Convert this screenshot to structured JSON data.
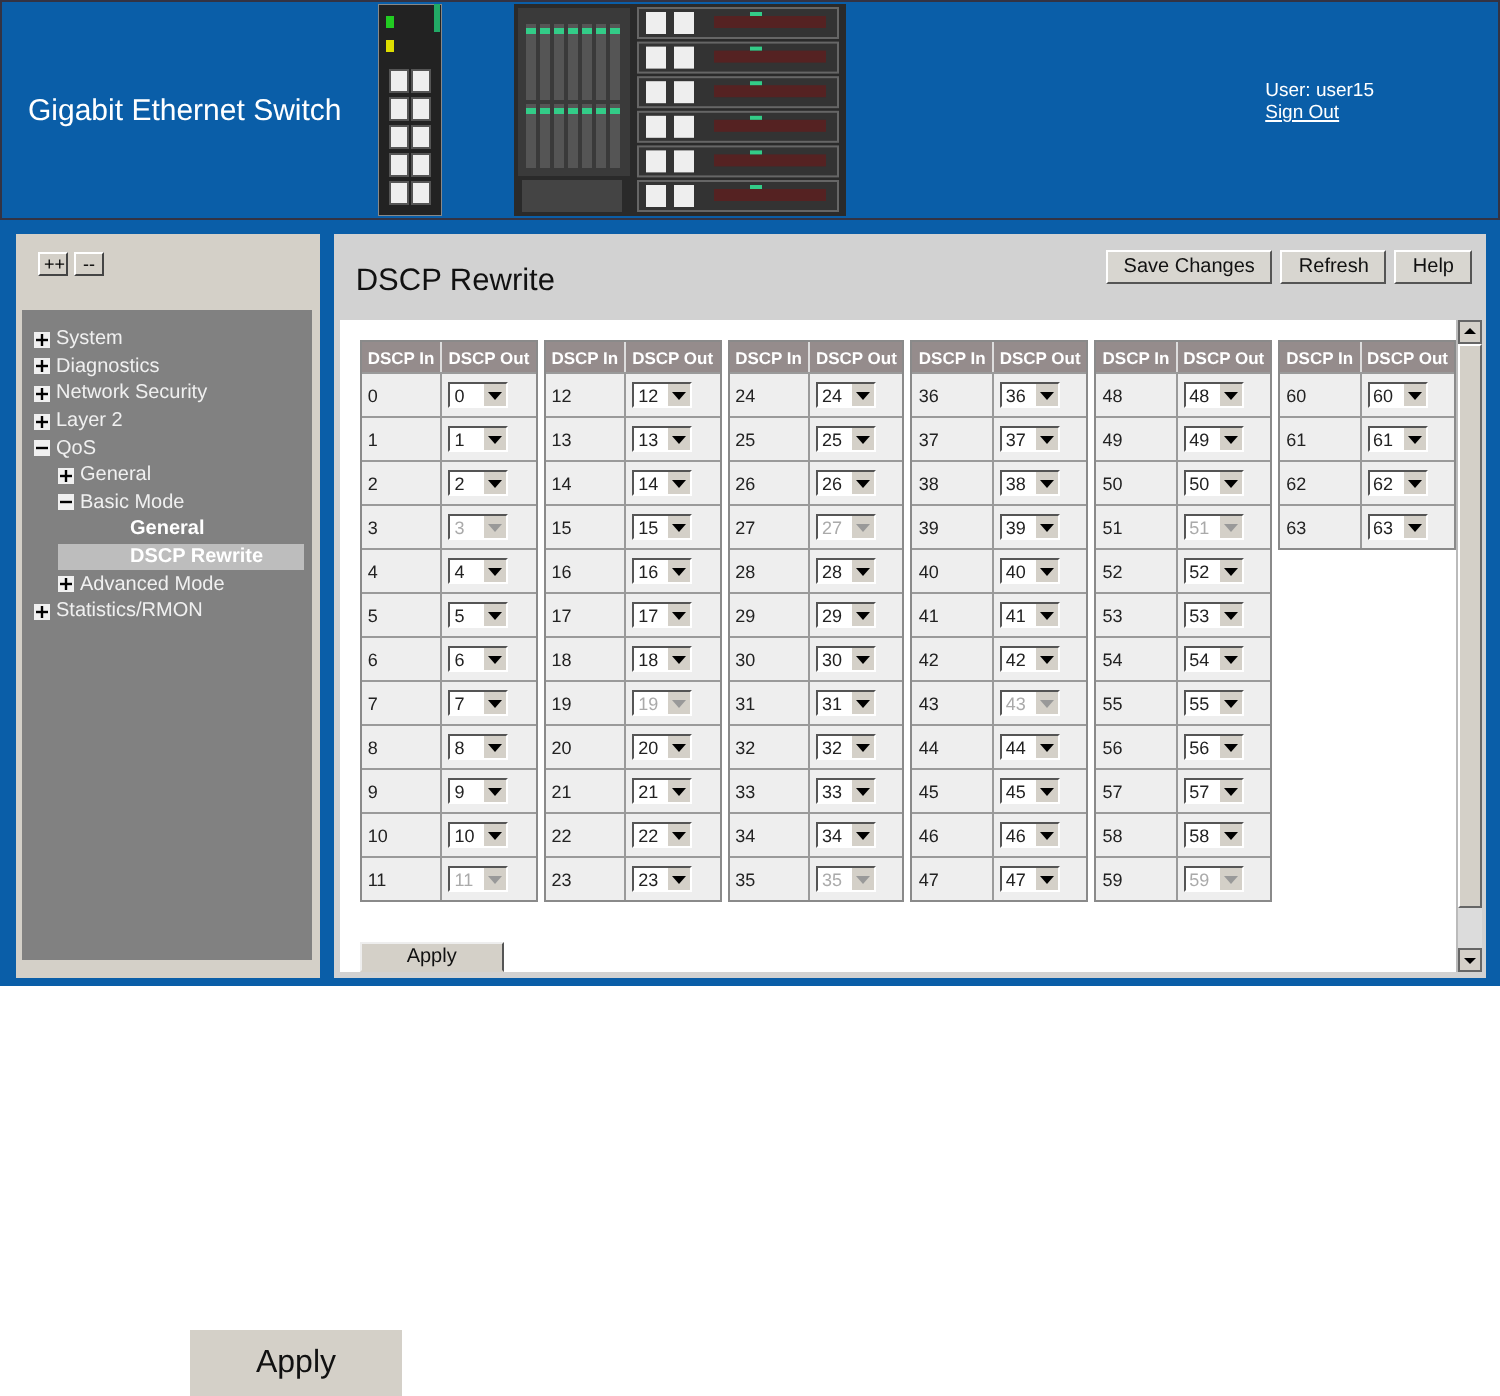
{
  "header": {
    "title": "Gigabit Ethernet Switch",
    "user": "User: user15",
    "sign_out": "Sign Out"
  },
  "sidebar": {
    "expand_all": "++",
    "collapse_all": "--",
    "tree": [
      {
        "label": "System",
        "kind": "folder",
        "expanded": false
      },
      {
        "label": "Diagnostics",
        "kind": "folder",
        "expanded": false
      },
      {
        "label": "Network Security",
        "kind": "folder",
        "expanded": false
      },
      {
        "label": "Layer 2",
        "kind": "folder",
        "expanded": false
      },
      {
        "label": "QoS",
        "kind": "folder",
        "expanded": true,
        "children": [
          {
            "label": "General",
            "kind": "folder",
            "expanded": false
          },
          {
            "label": "Basic Mode",
            "kind": "folder",
            "expanded": true,
            "children": [
              {
                "label": "General",
                "kind": "leaf",
                "selected": false
              },
              {
                "label": "DSCP Rewrite",
                "kind": "leaf",
                "selected": true
              }
            ]
          },
          {
            "label": "Advanced Mode",
            "kind": "folder",
            "expanded": false
          }
        ]
      },
      {
        "label": "Statistics/RMON",
        "kind": "folder",
        "expanded": false
      }
    ]
  },
  "main": {
    "title": "DSCP Rewrite",
    "buttons": [
      "Save Changes",
      "Refresh",
      "Help"
    ],
    "tables": [
      {
        "columns": [
          "DSCP In",
          "DSCP Out"
        ],
        "rows": [
          {
            "in": "0",
            "out": "0",
            "disabled": false
          },
          {
            "in": "1",
            "out": "1",
            "disabled": false
          },
          {
            "in": "2",
            "out": "2",
            "disabled": false
          },
          {
            "in": "3",
            "out": "3",
            "disabled": true
          },
          {
            "in": "4",
            "out": "4",
            "disabled": false
          },
          {
            "in": "5",
            "out": "5",
            "disabled": false
          },
          {
            "in": "6",
            "out": "6",
            "disabled": false
          },
          {
            "in": "7",
            "out": "7",
            "disabled": false
          },
          {
            "in": "8",
            "out": "8",
            "disabled": false
          },
          {
            "in": "9",
            "out": "9",
            "disabled": false
          },
          {
            "in": "10",
            "out": "10",
            "disabled": false
          },
          {
            "in": "11",
            "out": "11",
            "disabled": true
          }
        ]
      },
      {
        "columns": [
          "DSCP In",
          "DSCP Out"
        ],
        "rows": [
          {
            "in": "12",
            "out": "12",
            "disabled": false
          },
          {
            "in": "13",
            "out": "13",
            "disabled": false
          },
          {
            "in": "14",
            "out": "14",
            "disabled": false
          },
          {
            "in": "15",
            "out": "15",
            "disabled": false
          },
          {
            "in": "16",
            "out": "16",
            "disabled": false
          },
          {
            "in": "17",
            "out": "17",
            "disabled": false
          },
          {
            "in": "18",
            "out": "18",
            "disabled": false
          },
          {
            "in": "19",
            "out": "19",
            "disabled": true
          },
          {
            "in": "20",
            "out": "20",
            "disabled": false
          },
          {
            "in": "21",
            "out": "21",
            "disabled": false
          },
          {
            "in": "22",
            "out": "22",
            "disabled": false
          },
          {
            "in": "23",
            "out": "23",
            "disabled": false
          }
        ]
      },
      {
        "columns": [
          "DSCP In",
          "DSCP Out"
        ],
        "rows": [
          {
            "in": "24",
            "out": "24",
            "disabled": false
          },
          {
            "in": "25",
            "out": "25",
            "disabled": false
          },
          {
            "in": "26",
            "out": "26",
            "disabled": false
          },
          {
            "in": "27",
            "out": "27",
            "disabled": true
          },
          {
            "in": "28",
            "out": "28",
            "disabled": false
          },
          {
            "in": "29",
            "out": "29",
            "disabled": false
          },
          {
            "in": "30",
            "out": "30",
            "disabled": false
          },
          {
            "in": "31",
            "out": "31",
            "disabled": false
          },
          {
            "in": "32",
            "out": "32",
            "disabled": false
          },
          {
            "in": "33",
            "out": "33",
            "disabled": false
          },
          {
            "in": "34",
            "out": "34",
            "disabled": false
          },
          {
            "in": "35",
            "out": "35",
            "disabled": true
          }
        ]
      },
      {
        "columns": [
          "DSCP In",
          "DSCP Out"
        ],
        "rows": [
          {
            "in": "36",
            "out": "36",
            "disabled": false
          },
          {
            "in": "37",
            "out": "37",
            "disabled": false
          },
          {
            "in": "38",
            "out": "38",
            "disabled": false
          },
          {
            "in": "39",
            "out": "39",
            "disabled": false
          },
          {
            "in": "40",
            "out": "40",
            "disabled": false
          },
          {
            "in": "41",
            "out": "41",
            "disabled": false
          },
          {
            "in": "42",
            "out": "42",
            "disabled": false
          },
          {
            "in": "43",
            "out": "43",
            "disabled": true
          },
          {
            "in": "44",
            "out": "44",
            "disabled": false
          },
          {
            "in": "45",
            "out": "45",
            "disabled": false
          },
          {
            "in": "46",
            "out": "46",
            "disabled": false
          },
          {
            "in": "47",
            "out": "47",
            "disabled": false
          }
        ]
      },
      {
        "columns": [
          "DSCP In",
          "DSCP Out"
        ],
        "rows": [
          {
            "in": "48",
            "out": "48",
            "disabled": false
          },
          {
            "in": "49",
            "out": "49",
            "disabled": false
          },
          {
            "in": "50",
            "out": "50",
            "disabled": false
          },
          {
            "in": "51",
            "out": "51",
            "disabled": true
          },
          {
            "in": "52",
            "out": "52",
            "disabled": false
          },
          {
            "in": "53",
            "out": "53",
            "disabled": false
          },
          {
            "in": "54",
            "out": "54",
            "disabled": false
          },
          {
            "in": "55",
            "out": "55",
            "disabled": false
          },
          {
            "in": "56",
            "out": "56",
            "disabled": false
          },
          {
            "in": "57",
            "out": "57",
            "disabled": false
          },
          {
            "in": "58",
            "out": "58",
            "disabled": false
          },
          {
            "in": "59",
            "out": "59",
            "disabled": true
          }
        ]
      },
      {
        "columns": [
          "DSCP In",
          "DSCP Out"
        ],
        "rows": [
          {
            "in": "60",
            "out": "60",
            "disabled": false
          },
          {
            "in": "61",
            "out": "61",
            "disabled": false
          },
          {
            "in": "62",
            "out": "62",
            "disabled": false
          },
          {
            "in": "63",
            "out": "63",
            "disabled": false
          }
        ]
      }
    ],
    "apply": "Apply"
  },
  "bottom_apply": "Apply"
}
